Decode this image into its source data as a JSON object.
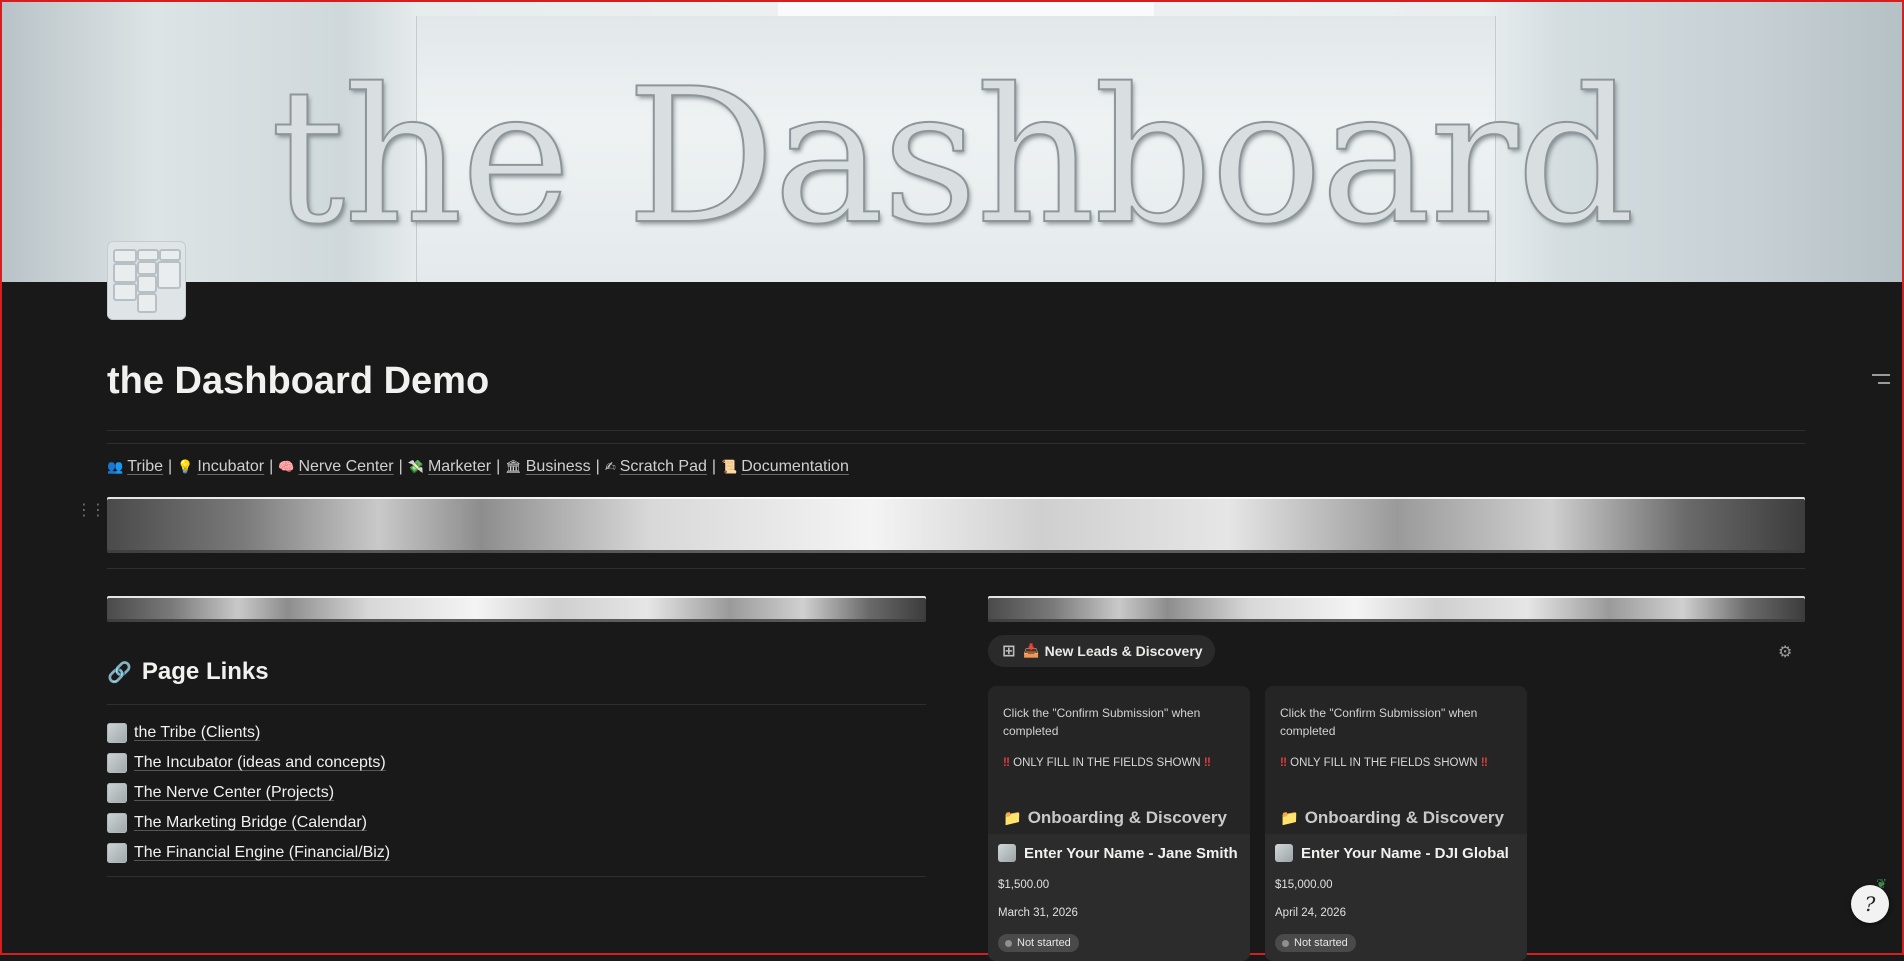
{
  "cover": {
    "title": "the Dashboard"
  },
  "page": {
    "title": "the Dashboard Demo"
  },
  "nav": {
    "items": [
      {
        "icon": "👥",
        "label": "Tribe"
      },
      {
        "icon": "💡",
        "label": "Incubator"
      },
      {
        "icon": "🧠",
        "label": "Nerve Center"
      },
      {
        "icon": "💸",
        "label": "Marketer"
      },
      {
        "icon": "🏛",
        "label": "Business"
      },
      {
        "icon": "✍",
        "label": "Scratch Pad"
      },
      {
        "icon": "📜",
        "label": "Documentation"
      }
    ],
    "separator": "|"
  },
  "page_links": {
    "heading": "Page Links",
    "heading_icon": "link-icon",
    "items": [
      "the Tribe (Clients)",
      "The Incubator (ideas and concepts)",
      "The Nerve Center (Projects)",
      "The Marketing Bridge (Calendar)",
      "The Financial Engine (Financial/Biz)"
    ]
  },
  "board": {
    "view_label": "New Leads & Discovery",
    "view_emoji": "📥",
    "cards": [
      {
        "note": "Click the \"Confirm Submission\" when completed",
        "warning_mark": "‼",
        "warning": "ONLY FILL IN THE FIELDS SHOWN",
        "group": "Onboarding & Discovery",
        "name": "Enter Your Name - Jane Smith",
        "amount": "$1,500.00",
        "date": "March 31, 2026",
        "status": "Not started"
      },
      {
        "note": "Click the \"Confirm Submission\" when completed",
        "warning_mark": "‼",
        "warning": "ONLY FILL IN THE FIELDS SHOWN",
        "group": "Onboarding & Discovery",
        "name": "Enter Your Name - DJI Global",
        "amount": "$15,000.00",
        "date": "April 24, 2026",
        "status": "Not started"
      }
    ]
  },
  "colors": {
    "background": "#191919",
    "card": "#252525",
    "status_red": "#e03e3e",
    "folder_blue": "#3d82c7"
  }
}
